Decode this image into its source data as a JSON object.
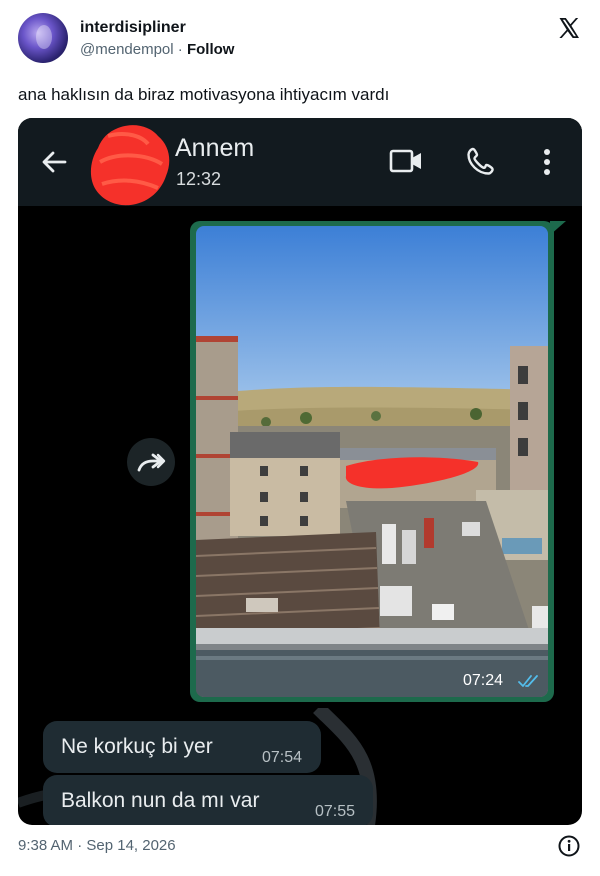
{
  "tweet": {
    "display_name": "interdisipliner",
    "handle": "@mendempol",
    "separator": "·",
    "follow_label": "Follow",
    "text": "ana haklısın da biraz motivasyona ihtiyacım vardı",
    "timestamp": "9:38 AM · Sep 14, 2026",
    "icons": {
      "brand": "x-logo-icon",
      "info": "info-icon"
    }
  },
  "chat": {
    "header": {
      "contact_name": "Annem",
      "last_seen": "12:32",
      "icons": [
        "back-arrow-icon",
        "video-call-icon",
        "phone-icon",
        "more-vertical-icon"
      ]
    },
    "messages": [
      {
        "type": "image",
        "direction": "outgoing",
        "time": "07:24",
        "status": "read"
      },
      {
        "type": "text",
        "direction": "incoming",
        "text": "Ne korkuç bi yer",
        "time": "07:54"
      },
      {
        "type": "text",
        "direction": "incoming",
        "text": "Balkon nun da mı var",
        "time": "07:55"
      }
    ],
    "colors": {
      "header_bg": "#121a1f",
      "outgoing_bubble": "#1d6a4c",
      "incoming_bubble": "#1f2c33",
      "read_ticks": "#53bdeb",
      "redaction": "#f5312a"
    }
  }
}
